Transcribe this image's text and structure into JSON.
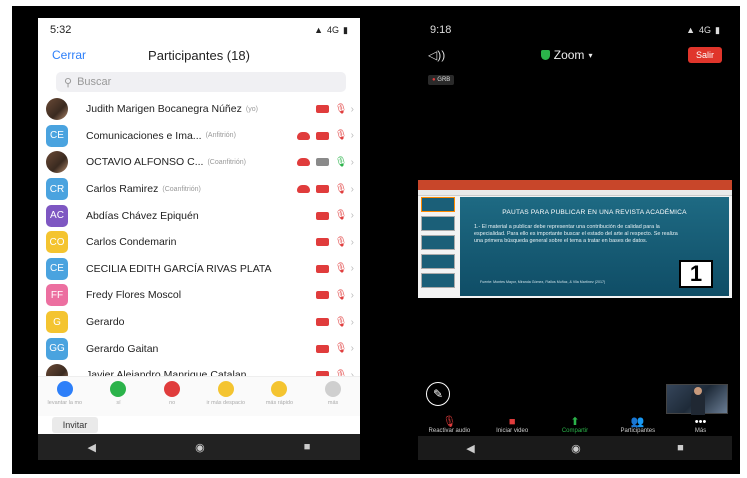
{
  "left_phone": {
    "status_time": "5:32",
    "status_right": "4G",
    "header": {
      "close_label": "Cerrar",
      "title": "Participantes (18)"
    },
    "search": {
      "placeholder": "Buscar"
    },
    "participants": [
      {
        "initials": "",
        "avatar_color": "#6b4a36",
        "photo": true,
        "name": "Judith Marigen Bocanegra Núñez",
        "role": "(yo)",
        "cloud": false,
        "camera": "red",
        "mic": "red"
      },
      {
        "initials": "CE",
        "avatar_color": "#4aa3df",
        "photo": false,
        "name": "Comunicaciones e Ima...",
        "role": "(Anfitrión)",
        "cloud": true,
        "camera": "red",
        "mic": "red"
      },
      {
        "initials": "",
        "avatar_color": "#3d3d3d",
        "photo": true,
        "name": "OCTAVIO ALFONSO C...",
        "role": "(Coanfitrión)",
        "cloud": true,
        "camera": "gray",
        "mic": "green"
      },
      {
        "initials": "CR",
        "avatar_color": "#4aa3df",
        "photo": false,
        "name": "Carlos Ramirez",
        "role": "(Coanfitrión)",
        "cloud": true,
        "camera": "red",
        "mic": "red"
      },
      {
        "initials": "AC",
        "avatar_color": "#7e57c2",
        "photo": false,
        "name": "Abdías Chávez Epiquén",
        "role": "",
        "cloud": false,
        "camera": "red",
        "mic": "red"
      },
      {
        "initials": "CO",
        "avatar_color": "#f4c430",
        "photo": false,
        "name": "Carlos Condemarin",
        "role": "",
        "cloud": false,
        "camera": "red",
        "mic": "red"
      },
      {
        "initials": "CE",
        "avatar_color": "#4aa3df",
        "photo": false,
        "name": "CECILIA EDITH GARCÍA RIVAS PLATA",
        "role": "",
        "cloud": false,
        "camera": "red",
        "mic": "red"
      },
      {
        "initials": "FF",
        "avatar_color": "#ec6fa0",
        "photo": false,
        "name": "Fredy Flores Moscol",
        "role": "",
        "cloud": false,
        "camera": "red",
        "mic": "red"
      },
      {
        "initials": "G",
        "avatar_color": "#f4c430",
        "photo": false,
        "name": "Gerardo",
        "role": "",
        "cloud": false,
        "camera": "red",
        "mic": "red"
      },
      {
        "initials": "GG",
        "avatar_color": "#4aa3df",
        "photo": false,
        "name": "Gerardo Gaitan",
        "role": "",
        "cloud": false,
        "camera": "red",
        "mic": "red"
      },
      {
        "initials": "",
        "avatar_color": "#6b4a36",
        "photo": true,
        "name": "Javier Alejandro Manrique Catalan",
        "role": "",
        "cloud": false,
        "camera": "red",
        "mic": "red"
      }
    ],
    "reactions": [
      {
        "label": "levantar la mo",
        "color": "#2d7ff9"
      },
      {
        "label": "sí",
        "color": "#2bb34a"
      },
      {
        "label": "no",
        "color": "#e03c3c"
      },
      {
        "label": "ir más despacio",
        "color": "#f4c430"
      },
      {
        "label": "más rápido",
        "color": "#f4c430"
      },
      {
        "label": "más",
        "color": "#cfcfcf"
      }
    ],
    "invite_label": "Invitar"
  },
  "right_phone": {
    "status_time": "9:18",
    "status_right": "4G",
    "meeting_label": "Zoom",
    "leave_label": "Salir",
    "rec_label": "GRB",
    "slide": {
      "title": "PAUTAS PARA PUBLICAR EN UNA REVISTA ACADÉMICA",
      "body": "1.- El material a publicar debe representar una contribución de calidad para la especialidad. Para ello es importante buscar el estado del arte al respecto. Se realiza una primera búsqueda general sobre el tema a tratar en bases de datos.",
      "citation": "Fuente: Montes Mayor, Miranda Gómez, Fiallos Muñoz, & Vila Martínez (2017)",
      "number": "1"
    },
    "toolbar": [
      {
        "label": "Reactivar audio",
        "icon": "mic-off-icon",
        "color": "red"
      },
      {
        "label": "Iniciar video",
        "icon": "video-off-icon",
        "color": "red"
      },
      {
        "label": "Compartir",
        "icon": "share-icon",
        "color": "green"
      },
      {
        "label": "Participantes",
        "icon": "participants-icon",
        "color": "white"
      },
      {
        "label": "Más",
        "icon": "more-icon",
        "color": "white"
      }
    ]
  }
}
